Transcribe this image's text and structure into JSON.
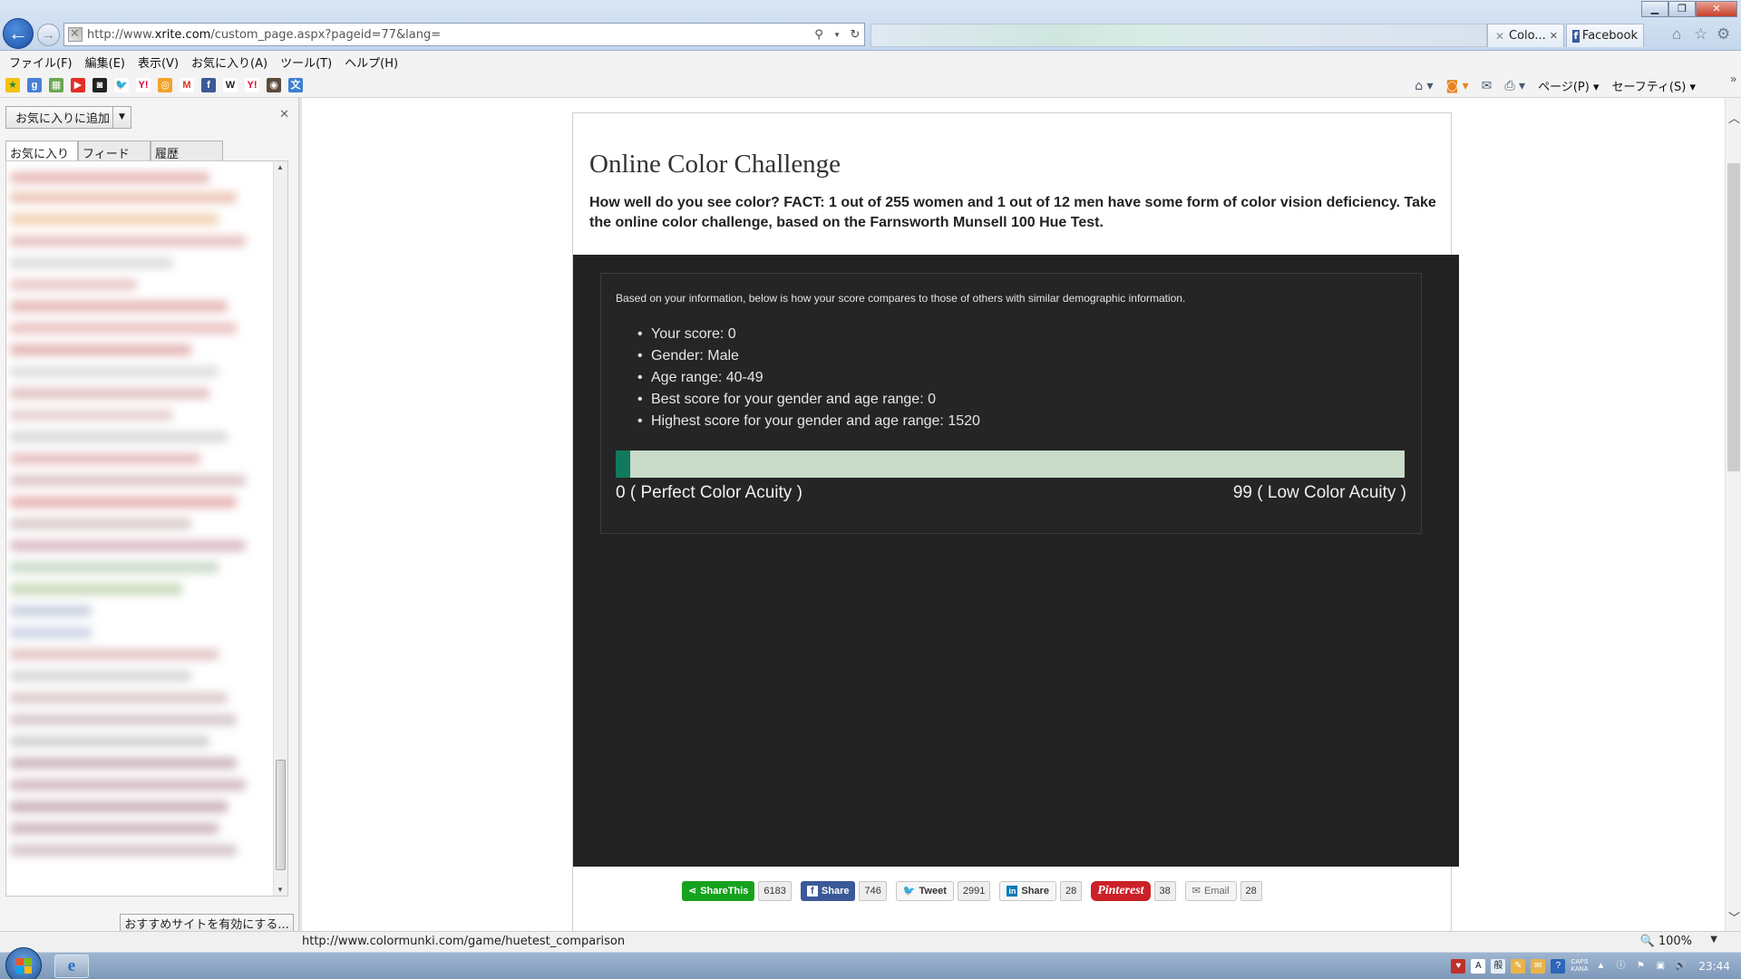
{
  "browser": {
    "address_prefix": "http://www.",
    "address_domain": "xrite.com",
    "address_path": "/custom_page.aspx?pageid=77&lang=",
    "tabs": [
      {
        "label": "Colo...",
        "active": true
      },
      {
        "label": "Facebook",
        "active": false
      }
    ],
    "window_controls": {
      "minimize": "▁",
      "restore": "❐",
      "close": "✕"
    }
  },
  "menu": [
    "ファイル(F)",
    "編集(E)",
    "表示(V)",
    "お気に入り(A)",
    "ツール(T)",
    "ヘルプ(H)"
  ],
  "command_bar": {
    "page_menu": "ページ(P)",
    "safety_menu": "セーフティ(S)"
  },
  "favorites_pane": {
    "add_button": "お気に入りに追加",
    "tabs": [
      "お気に入り",
      "フィード",
      "履歴"
    ],
    "suggest_button": "おすすめサイトを有効にする..."
  },
  "page": {
    "title": "Online Color Challenge",
    "intro": "How well do you see color? FACT: 1 out of 255 women and 1 out of 12 men have some form of color vision deficiency. Take the online color challenge, based on the Farnsworth Munsell 100 Hue Test.",
    "result_intro": "Based on your information, below is how your score compares to those of others with similar demographic information.",
    "results": [
      "Your score: 0",
      "Gender: Male",
      "Age range: 40-49",
      "Best score for your gender and age range: 0",
      "Highest score for your gender and age range: 1520"
    ],
    "acuity": {
      "min_label": "0 ( Perfect Color Acuity )",
      "max_label": "99 ( Low Color Acuity )",
      "fill_fraction": 0.018,
      "fill_color": "#127a5c",
      "track_color": "#c9dcc9"
    },
    "share": {
      "sharethis": {
        "label": "ShareThis",
        "count": "6183"
      },
      "facebook": {
        "label": "Share",
        "count": "746"
      },
      "twitter": {
        "label": "Tweet",
        "count": "2991"
      },
      "linkedin": {
        "label": "Share",
        "count": "28"
      },
      "pinterest": {
        "label": "Pinterest",
        "count": "38"
      },
      "email": {
        "label": "Email",
        "count": "28"
      }
    }
  },
  "status": {
    "url": "http://www.colormunki.com/game/huetest_comparison",
    "zoom": "100%"
  },
  "taskbar": {
    "clock": "23:44",
    "caps": "CAPS",
    "kana": "KANA"
  }
}
